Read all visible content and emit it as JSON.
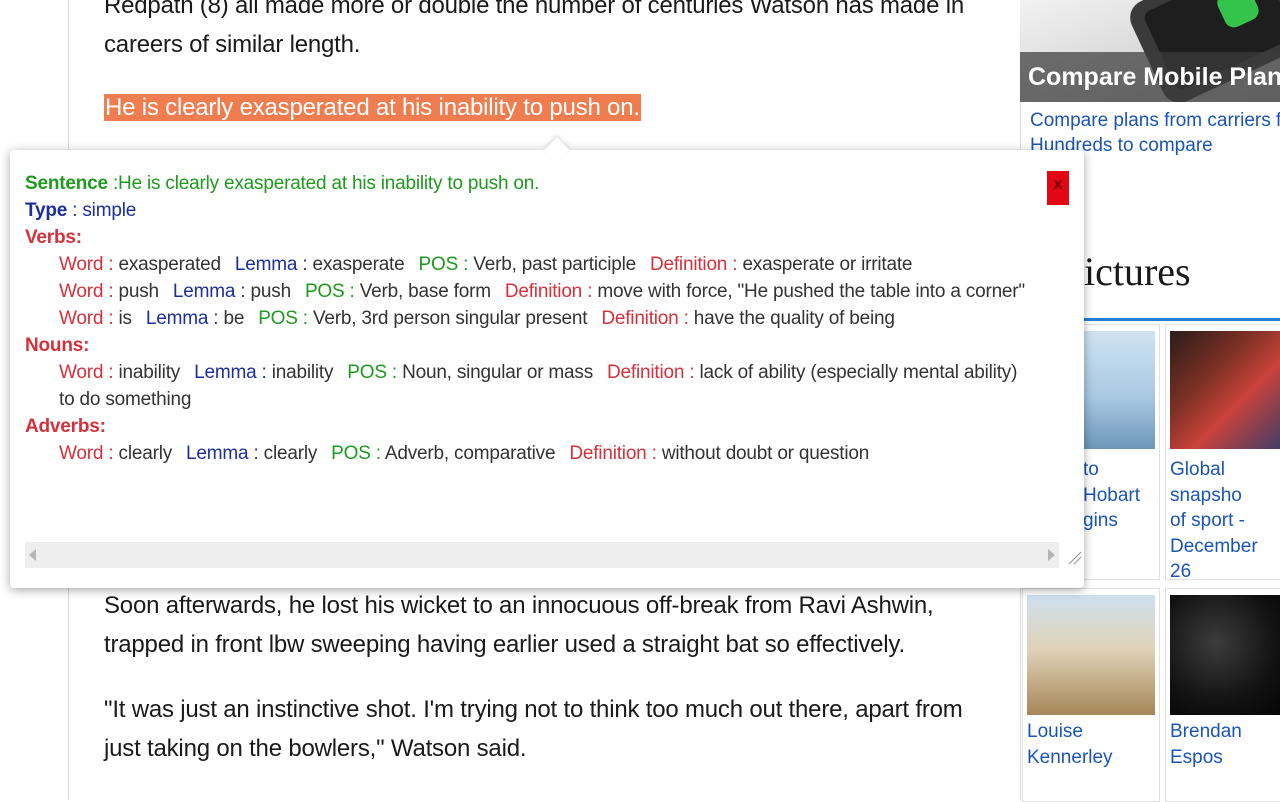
{
  "article": {
    "para_top": "Redpath (8) all made more or double the number of centuries Watson has made in careers of similar length.",
    "highlight": "He is clearly exasperated at his inability to push on.",
    "para_after": "Soon afterwards, he lost his wicket to an innocuous off-break from Ravi Ashwin, trapped in front lbw sweeping having earlier used a straight bat so effectively.",
    "para_quote": "\"It was just an instinctive shot. I'm trying not to think too much out there, apart from just taking on the bowlers,\" Watson said."
  },
  "ad": {
    "headline": "Compare Mobile Plans fo",
    "body_line1": "Compare plans from carriers for iPh",
    "body_line2": "Hundreds to compare"
  },
  "pictures": {
    "title": "ictures",
    "tiles": [
      {
        "caption": "to Hobart\ngins"
      },
      {
        "caption": "Global snapsho\nof sport -\nDecember 26"
      },
      {
        "caption": "Louise Kennerley"
      },
      {
        "caption": "Brendan Espos"
      }
    ]
  },
  "popup": {
    "sentence_label": "Sentence",
    "sentence_value": " :He is clearly exasperated at his inability to push on.",
    "type_label": "Type",
    "type_value": " : simple",
    "sep": " : ",
    "verbs_label": "Verbs:",
    "nouns_label": "Nouns:",
    "adverbs_label": "Adverbs:",
    "word_label": "Word",
    "lemma_label": "Lemma",
    "pos_label": "POS",
    "definition_label": "Definition",
    "close_label": "x",
    "verbs": [
      {
        "word": "exasperated",
        "lemma": "exasperate",
        "pos": "Verb, past participle",
        "definition": "exasperate or irritate"
      },
      {
        "word": "push",
        "lemma": "push",
        "pos": "Verb, base form",
        "definition": "move with force, \"He pushed the table into a corner\""
      },
      {
        "word": "is",
        "lemma": "be",
        "pos": "Verb, 3rd person singular present",
        "definition": "have the quality of being"
      }
    ],
    "nouns": [
      {
        "word": "inability",
        "lemma": "inability",
        "pos": "Noun, singular or mass",
        "definition": "lack of ability (especially mental ability) to do something"
      }
    ],
    "adverbs": [
      {
        "word": "clearly",
        "lemma": "clearly",
        "pos": "Adverb, comparative",
        "definition": "without doubt or question"
      }
    ]
  },
  "colors": {
    "highlight": "#ef7d4f",
    "close": "#e30613",
    "link": "#1a55b5",
    "label_green": "#1e9a1e",
    "label_blue": "#1c2f9c",
    "label_red": "#d4313b"
  }
}
